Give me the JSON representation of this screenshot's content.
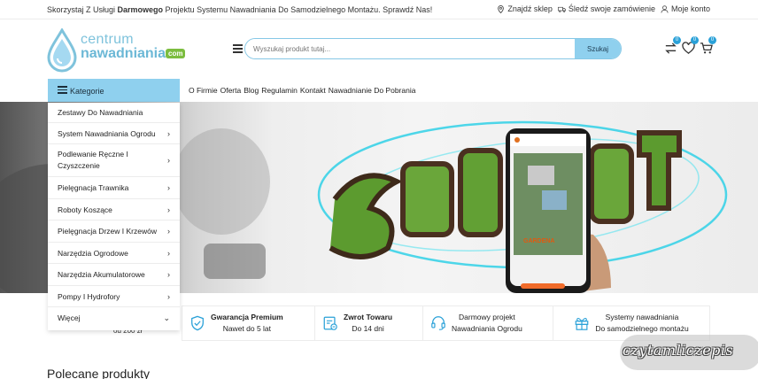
{
  "topbar": {
    "promo_prefix": "Skorzystaj Z Usługi ",
    "promo_bold": "Darmowego",
    "promo_suffix": " Projektu Systemu Nawadniania Do Samodzielnego Montażu. Sprawdź Nas!",
    "find_store": "Znajdź sklep",
    "track_order": "Śledź swoje zamówienie",
    "account": "Moje konto"
  },
  "logo": {
    "line1": "centrum",
    "line2": "nawadniania",
    "suffix": "com"
  },
  "search": {
    "placeholder": "Wyszukaj produkt tutaj...",
    "button": "Szukaj"
  },
  "header_icons": [
    {
      "icon": "compare-icon",
      "count": "0"
    },
    {
      "icon": "heart-icon",
      "count": "0"
    },
    {
      "icon": "cart-icon",
      "count": "0"
    }
  ],
  "nav": {
    "categories_label": "Kategorie",
    "links": [
      "O Firmie",
      "Oferta",
      "Blog",
      "Regulamin",
      "Kontakt",
      "Nawadnianie Do Pobrania"
    ]
  },
  "categories": [
    {
      "label": "Zestawy Do Nawadniania",
      "arrow": ""
    },
    {
      "label": "System Nawadniania Ogrodu",
      "arrow": "›"
    },
    {
      "label": "Podlewanie Ręczne I Czyszczenie",
      "arrow": "›"
    },
    {
      "label": "Pielęgnacja Trawnika",
      "arrow": "›"
    },
    {
      "label": "Roboty Koszące",
      "arrow": "›"
    },
    {
      "label": "Pielęgnacja Drzew I Krzewów",
      "arrow": "›"
    },
    {
      "label": "Narzędzia Ogrodowe",
      "arrow": "›"
    },
    {
      "label": "Narzędzia Akumulatorowe",
      "arrow": "›"
    },
    {
      "label": "Pompy I Hydrofory",
      "arrow": "›"
    },
    {
      "label": "Więcej",
      "arrow": "⌄"
    }
  ],
  "hero": {
    "phone_brand": "GARDENA"
  },
  "features": [
    {
      "icon": "shield-check-icon",
      "title": "Gwarancja Premium",
      "text": "Nawet do 5 lat"
    },
    {
      "icon": "return-box-icon",
      "title": "Zwrot Towaru",
      "text": "Do 14 dni"
    },
    {
      "icon": "headset-icon",
      "title": "",
      "text": "Darmowy projekt",
      "text2": "Nawadniania Ogrodu"
    },
    {
      "icon": "gift-icon",
      "title": "",
      "text": "Systemy nawadniania",
      "text2": "Do samodzielnego montażu"
    }
  ],
  "left_feature_partial": "od 200 zł",
  "section_title": "Polecane produkty",
  "watermark": "czytamliczepis",
  "colors": {
    "accent": "#8fd0ee",
    "brand_blue": "#6cb8d6",
    "brand_green": "#7cbd3f",
    "badge": "#2aa1d8"
  }
}
